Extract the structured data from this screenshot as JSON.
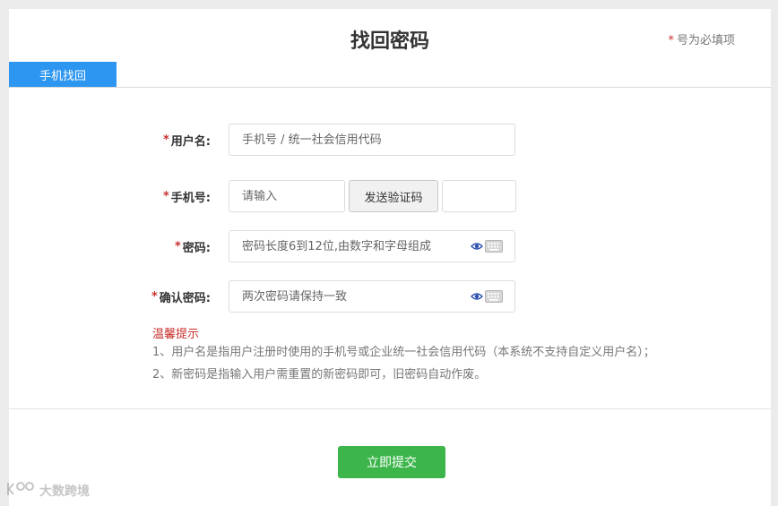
{
  "header": {
    "title": "找回密码",
    "required_star": "*",
    "required_note": "号为必填项"
  },
  "tabs": [
    {
      "label": "手机找回",
      "active": true
    }
  ],
  "form": {
    "username": {
      "star": "*",
      "label": "用户名:",
      "placeholder": "手机号 / 统一社会信用代码"
    },
    "phone": {
      "star": "*",
      "label": "手机号:",
      "placeholder": "请输入",
      "send_code_label": "发送验证码",
      "code_value": ""
    },
    "password": {
      "star": "*",
      "label": "密码:",
      "placeholder": "密码长度6到12位,由数字和字母组成"
    },
    "confirm_password": {
      "star": "*",
      "label": "确认密码:",
      "placeholder": "两次密码请保持一致"
    }
  },
  "tips": {
    "title": "温馨提示",
    "items": [
      "1、用户名是指用户注册时使用的手机号或企业统一社会信用代码（本系统不支持自定义用户名）；",
      "2、新密码是指输入用户需重置的新密码即可，旧密码自动作废。"
    ]
  },
  "submit_label": "立即提交",
  "watermark_text": "大数跨境",
  "colors": {
    "accent_blue": "#2d96f0",
    "submit_green": "#3cb64b",
    "required_red": "#c9302c"
  },
  "icons": [
    "eye-icon",
    "keyboard-icon",
    "watermark-logo-icon"
  ]
}
